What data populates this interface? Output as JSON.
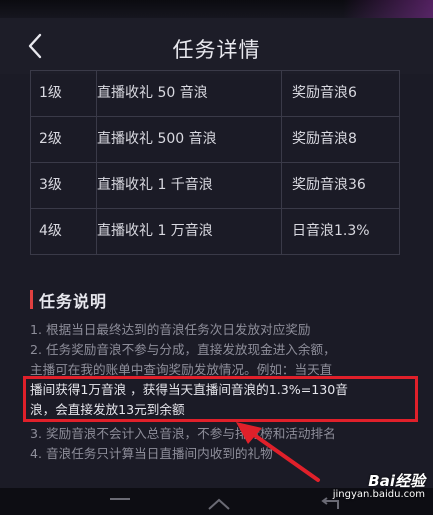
{
  "header": {
    "title": "任务详情",
    "back_icon": "chevron-left-icon"
  },
  "table": {
    "rows": [
      {
        "level": "1级",
        "task": "直播收礼 50 音浪",
        "reward": "奖励音浪6"
      },
      {
        "level": "2级",
        "task": "直播收礼 500 音浪",
        "reward": "奖励音浪8"
      },
      {
        "level": "3级",
        "task": "直播收礼 1 千音浪",
        "reward": "奖励音浪36"
      },
      {
        "level": "4级",
        "task": "直播收礼 1 万音浪",
        "reward": "日音浪1.3%"
      }
    ]
  },
  "section": {
    "title": "任务说明",
    "lines_before": [
      "1. 根据当日最终达到的音浪任务次日发放对应奖励",
      "2. 任务奖励音浪不参与分成，直接发放现金进入余额，",
      "主播可在我的账单中查询奖励发放情况。例如：当天直"
    ],
    "highlight_lines": [
      "播间获得1万音浪 ，获得当天直播间音浪的1.3%=130音",
      "浪，会直接发放13元到余额"
    ],
    "lines_after": [
      "3. 奖励音浪不会计入总音浪，不参与排行榜和活动排名",
      "4. 音浪任务只计算当日直播间内收到的礼物"
    ]
  },
  "watermark": {
    "logo": "Bai经验",
    "url": "jingyan.baidu.com"
  },
  "colors": {
    "background": "#1b1b26",
    "accent": "#e04040",
    "highlight_border": "#e0202a"
  }
}
